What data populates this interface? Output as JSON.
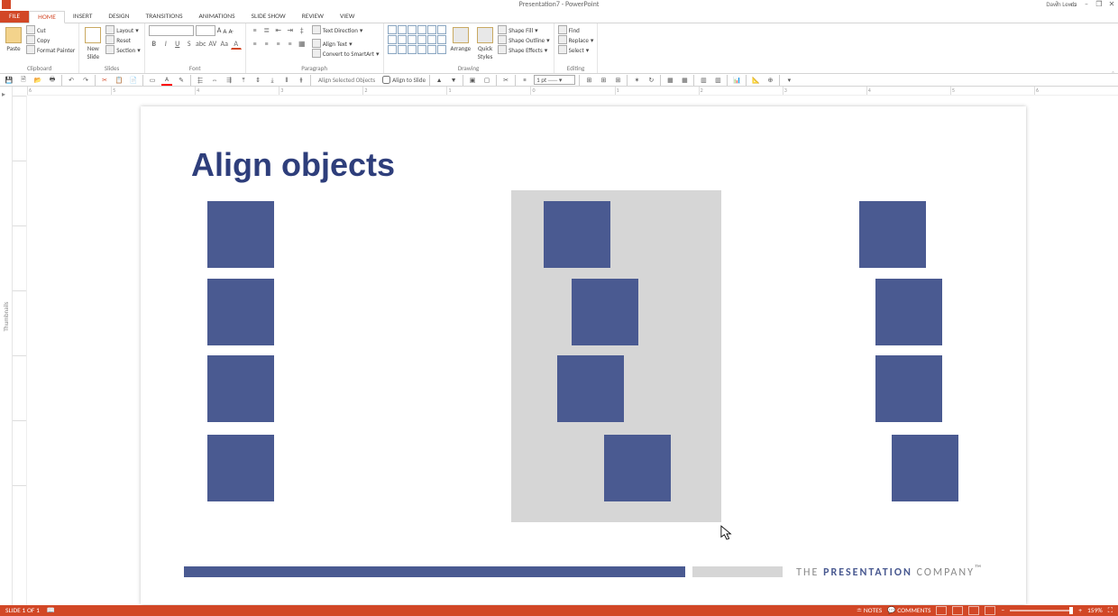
{
  "app": {
    "title": "Presentation7 - PowerPoint",
    "user": "Dawn Lewis"
  },
  "window_buttons": {
    "help": "?",
    "full": "▭",
    "min": "–",
    "restore": "❐",
    "close": "✕"
  },
  "tabs": [
    "FILE",
    "HOME",
    "INSERT",
    "DESIGN",
    "TRANSITIONS",
    "ANIMATIONS",
    "SLIDE SHOW",
    "REVIEW",
    "VIEW"
  ],
  "active_tab": "HOME",
  "ribbon": {
    "clipboard": {
      "label": "Clipboard",
      "paste": "Paste",
      "cut": "Cut",
      "copy": "Copy",
      "format_painter": "Format Painter"
    },
    "slides": {
      "label": "Slides",
      "new_slide": "New\nSlide",
      "layout": "Layout",
      "reset": "Reset",
      "section": "Section"
    },
    "font": {
      "label": "Font",
      "name": "",
      "size": ""
    },
    "paragraph": {
      "label": "Paragraph",
      "text_direction": "Text Direction",
      "align_text": "Align Text",
      "convert": "Convert to SmartArt"
    },
    "drawing": {
      "label": "Drawing",
      "arrange": "Arrange",
      "quick_styles": "Quick\nStyles",
      "shape_fill": "Shape Fill",
      "shape_outline": "Shape Outline",
      "shape_effects": "Shape Effects"
    },
    "editing": {
      "label": "Editing",
      "find": "Find",
      "replace": "Replace",
      "select": "Select"
    }
  },
  "qat2": {
    "align_selected": "Align Selected Objects",
    "align_to_slide": "Align to Slide",
    "weight": "1 pt"
  },
  "thumbnails_label": "Thumbnails",
  "slide": {
    "title": "Align objects",
    "company_pre": "THE ",
    "company_bold": "PRESENTATION",
    "company_post": " COMPANY",
    "tm": "™"
  },
  "status": {
    "slide": "SLIDE 1 OF 1",
    "lang": "",
    "notes": "NOTES",
    "comments": "COMMENTS",
    "zoom": "159%"
  }
}
